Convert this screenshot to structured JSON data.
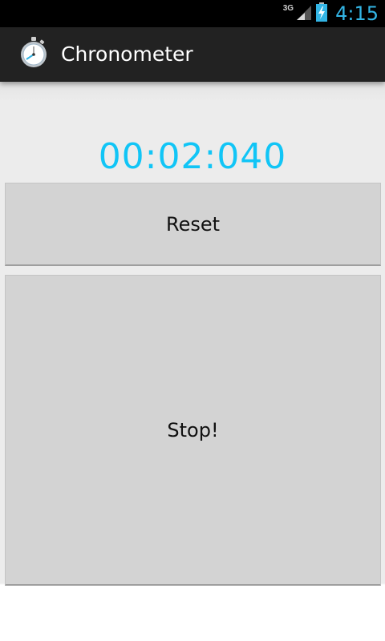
{
  "status_bar": {
    "network_label": "3G",
    "time": "4:15",
    "icons": [
      "signal-icon",
      "battery-charging-icon"
    ]
  },
  "action_bar": {
    "app_icon": "stopwatch-icon",
    "title": "Chronometer"
  },
  "timer": {
    "display": "00:02:040",
    "color": "#11c5f6"
  },
  "buttons": {
    "reset_label": "Reset",
    "stop_label": "Stop!"
  },
  "colors": {
    "status_accent": "#33b5e5",
    "action_bar_bg": "#222222",
    "button_bg": "#d3d3d3"
  }
}
